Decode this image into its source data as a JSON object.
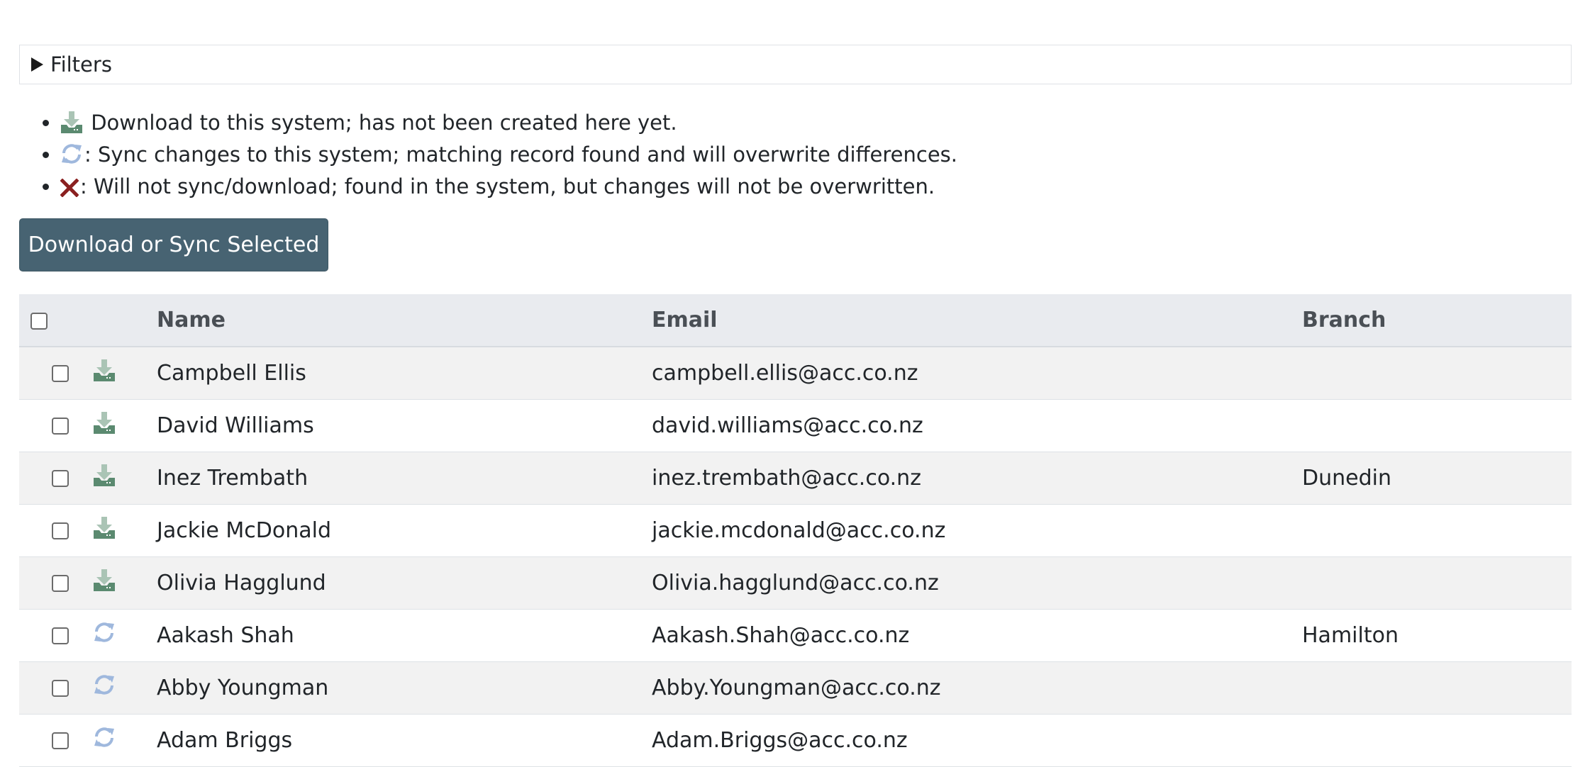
{
  "filters": {
    "label": "Filters"
  },
  "legend": [
    {
      "icon": "download-icon",
      "text": " Download to this system; has not been created here yet."
    },
    {
      "icon": "sync-icon",
      "text": ": Sync changes to this system; matching record found and will overwrite differences."
    },
    {
      "icon": "x-icon",
      "text": ": Will not sync/download; found in the system, but changes will not be overwritten."
    }
  ],
  "actions": {
    "download_sync_label": "Download or Sync Selected"
  },
  "table": {
    "headers": {
      "name": "Name",
      "email": "Email",
      "branch": "Branch"
    },
    "rows": [
      {
        "status": "download",
        "name": "Campbell Ellis",
        "email": "campbell.ellis@acc.co.nz",
        "branch": ""
      },
      {
        "status": "download",
        "name": "David Williams",
        "email": "david.williams@acc.co.nz",
        "branch": ""
      },
      {
        "status": "download",
        "name": "Inez Trembath",
        "email": "inez.trembath@acc.co.nz",
        "branch": "Dunedin"
      },
      {
        "status": "download",
        "name": "Jackie McDonald",
        "email": "jackie.mcdonald@acc.co.nz",
        "branch": ""
      },
      {
        "status": "download",
        "name": "Olivia Hagglund",
        "email": "Olivia.hagglund@acc.co.nz",
        "branch": ""
      },
      {
        "status": "sync",
        "name": "Aakash Shah",
        "email": "Aakash.Shah@acc.co.nz",
        "branch": "Hamilton"
      },
      {
        "status": "sync",
        "name": "Abby Youngman",
        "email": "Abby.Youngman@acc.co.nz",
        "branch": ""
      },
      {
        "status": "sync",
        "name": "Adam Briggs",
        "email": "Adam.Briggs@acc.co.nz",
        "branch": ""
      }
    ]
  },
  "colors": {
    "button_bg": "#476372",
    "download_dark": "#5b8a70",
    "download_light": "#aac4b5",
    "sync": "#9fb8dd",
    "x_mark": "#8a2020",
    "header_bg": "#e9ebef",
    "row_stripe": "#f2f2f2"
  }
}
